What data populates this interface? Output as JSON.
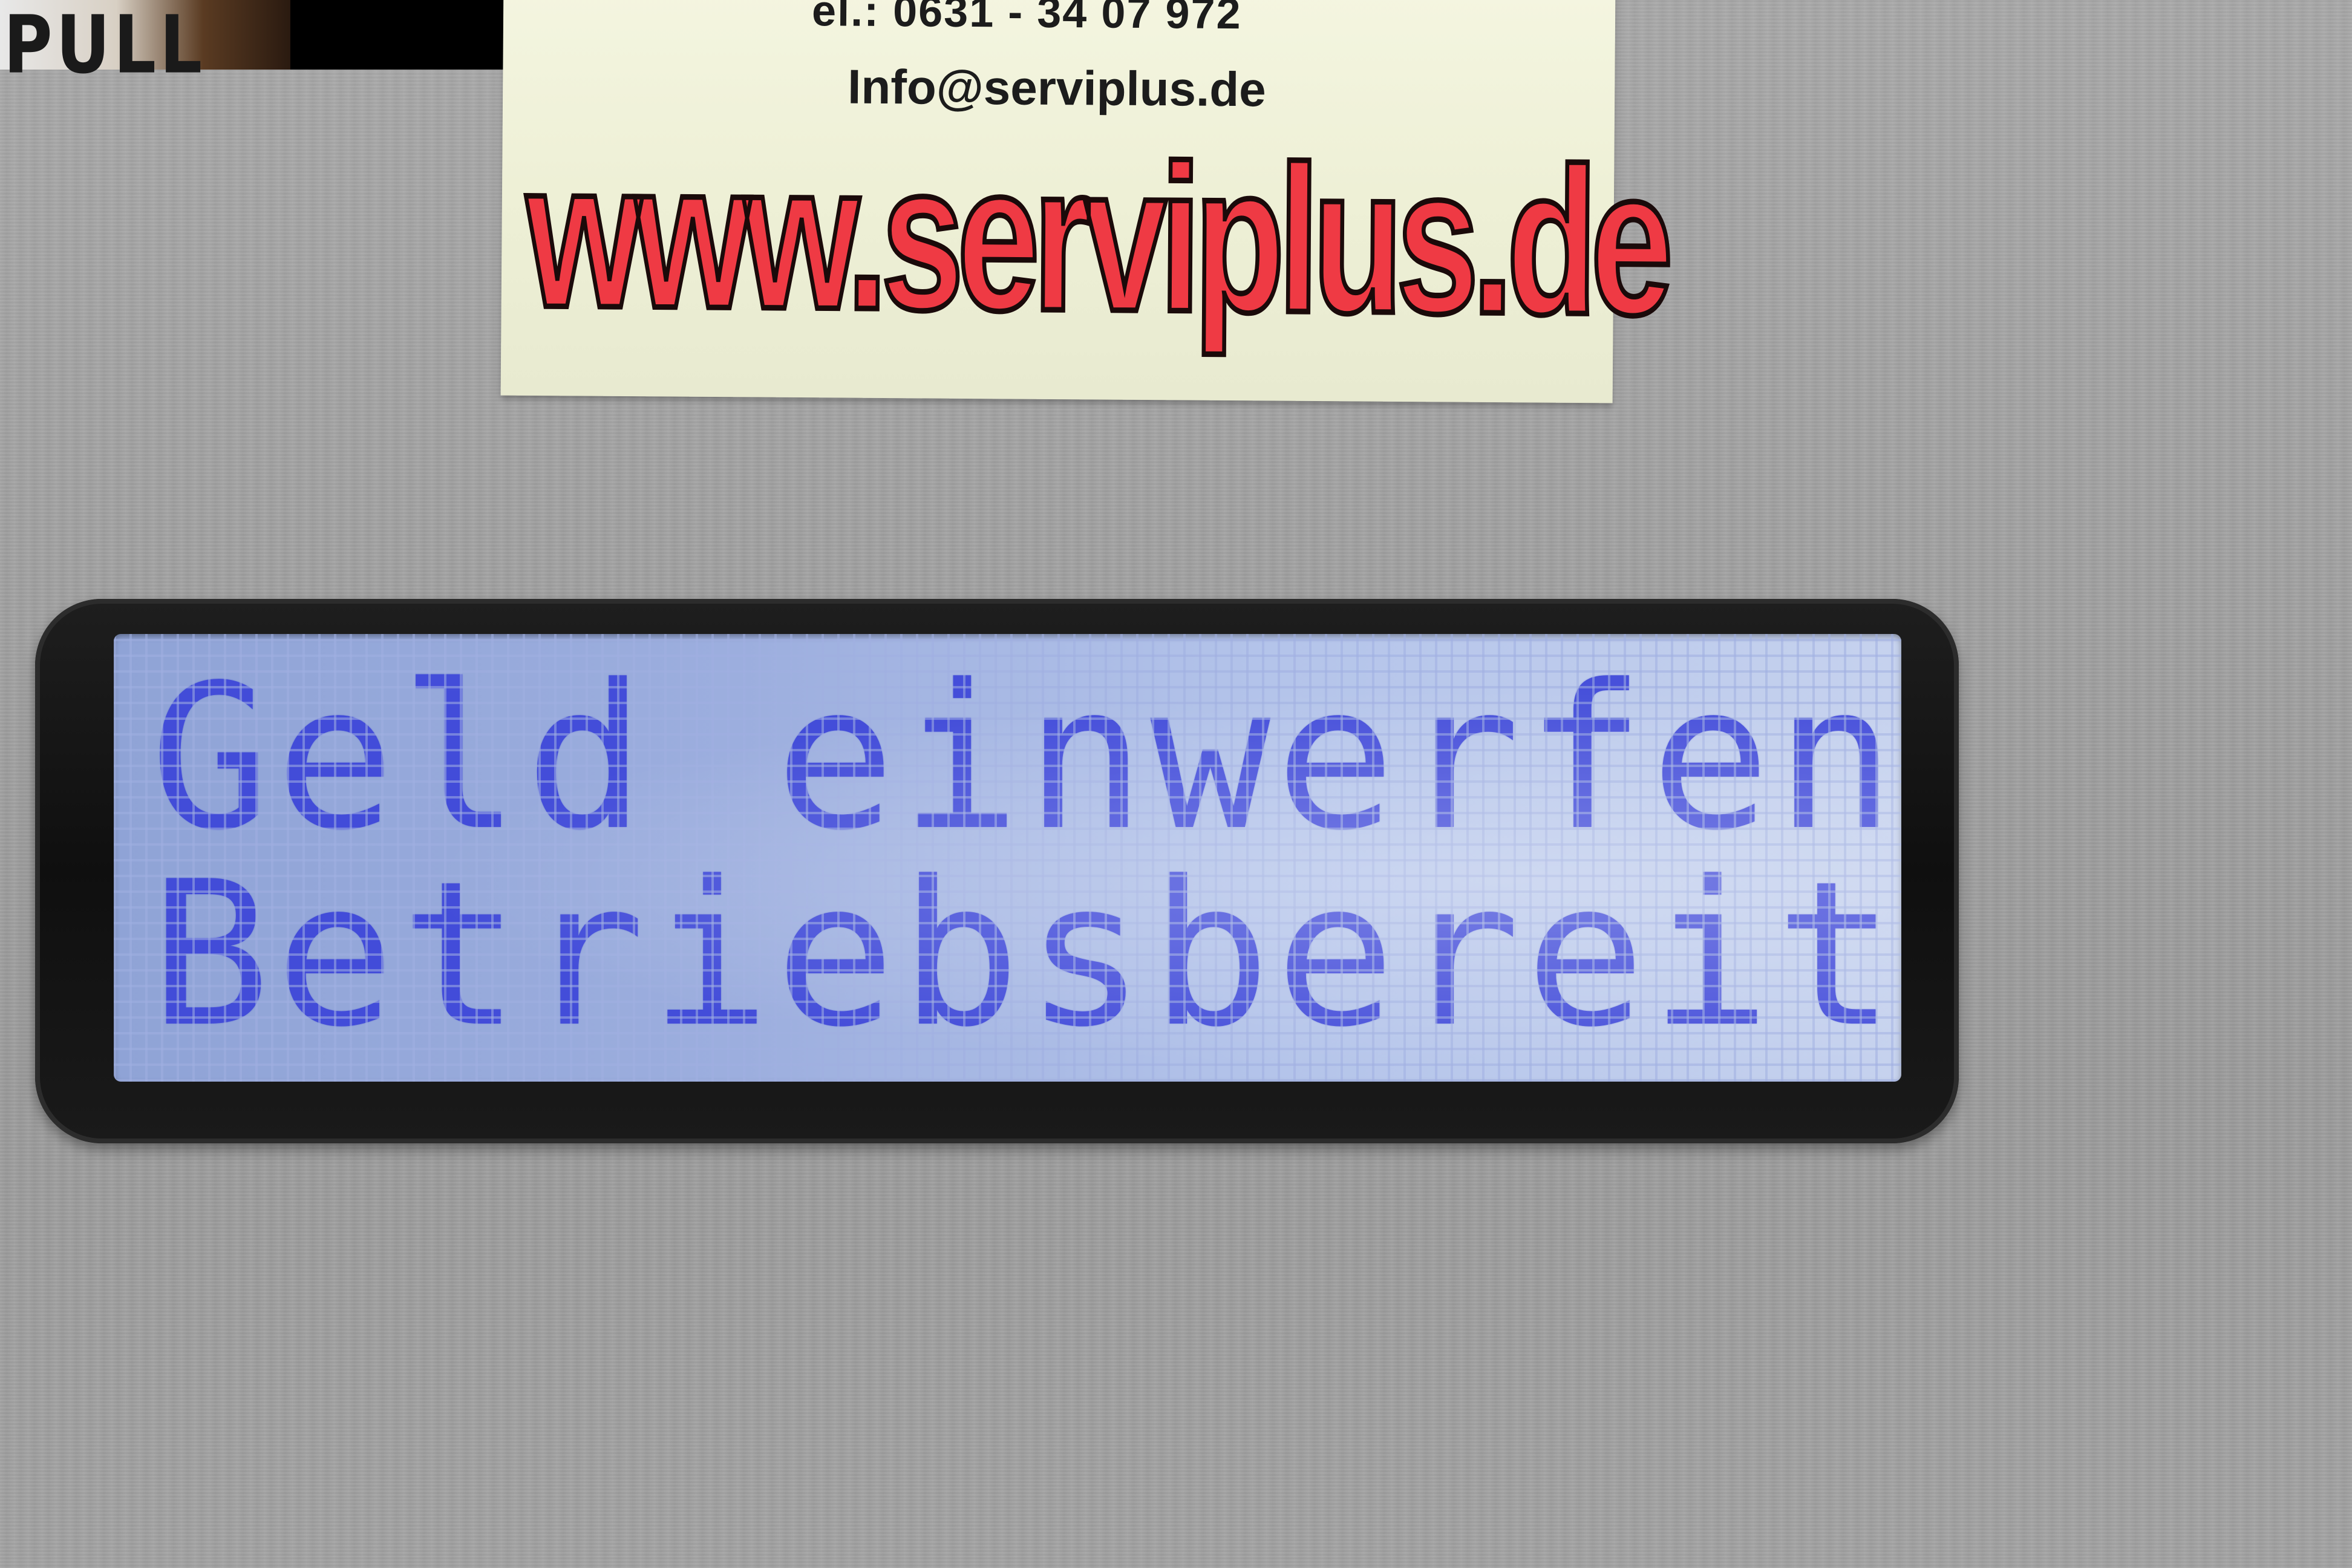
{
  "top_strip": {
    "text": "PULL"
  },
  "sticker": {
    "phone": "el.: 0631 - 34 07 972",
    "email": "Info@serviplus.de",
    "url": "www.serviplus.de"
  },
  "display": {
    "line1": "Geld einwerfen",
    "line2": "Betriebsbereit",
    "text_color": "#3a43d9",
    "backlight_color": "#a8b8e4"
  }
}
